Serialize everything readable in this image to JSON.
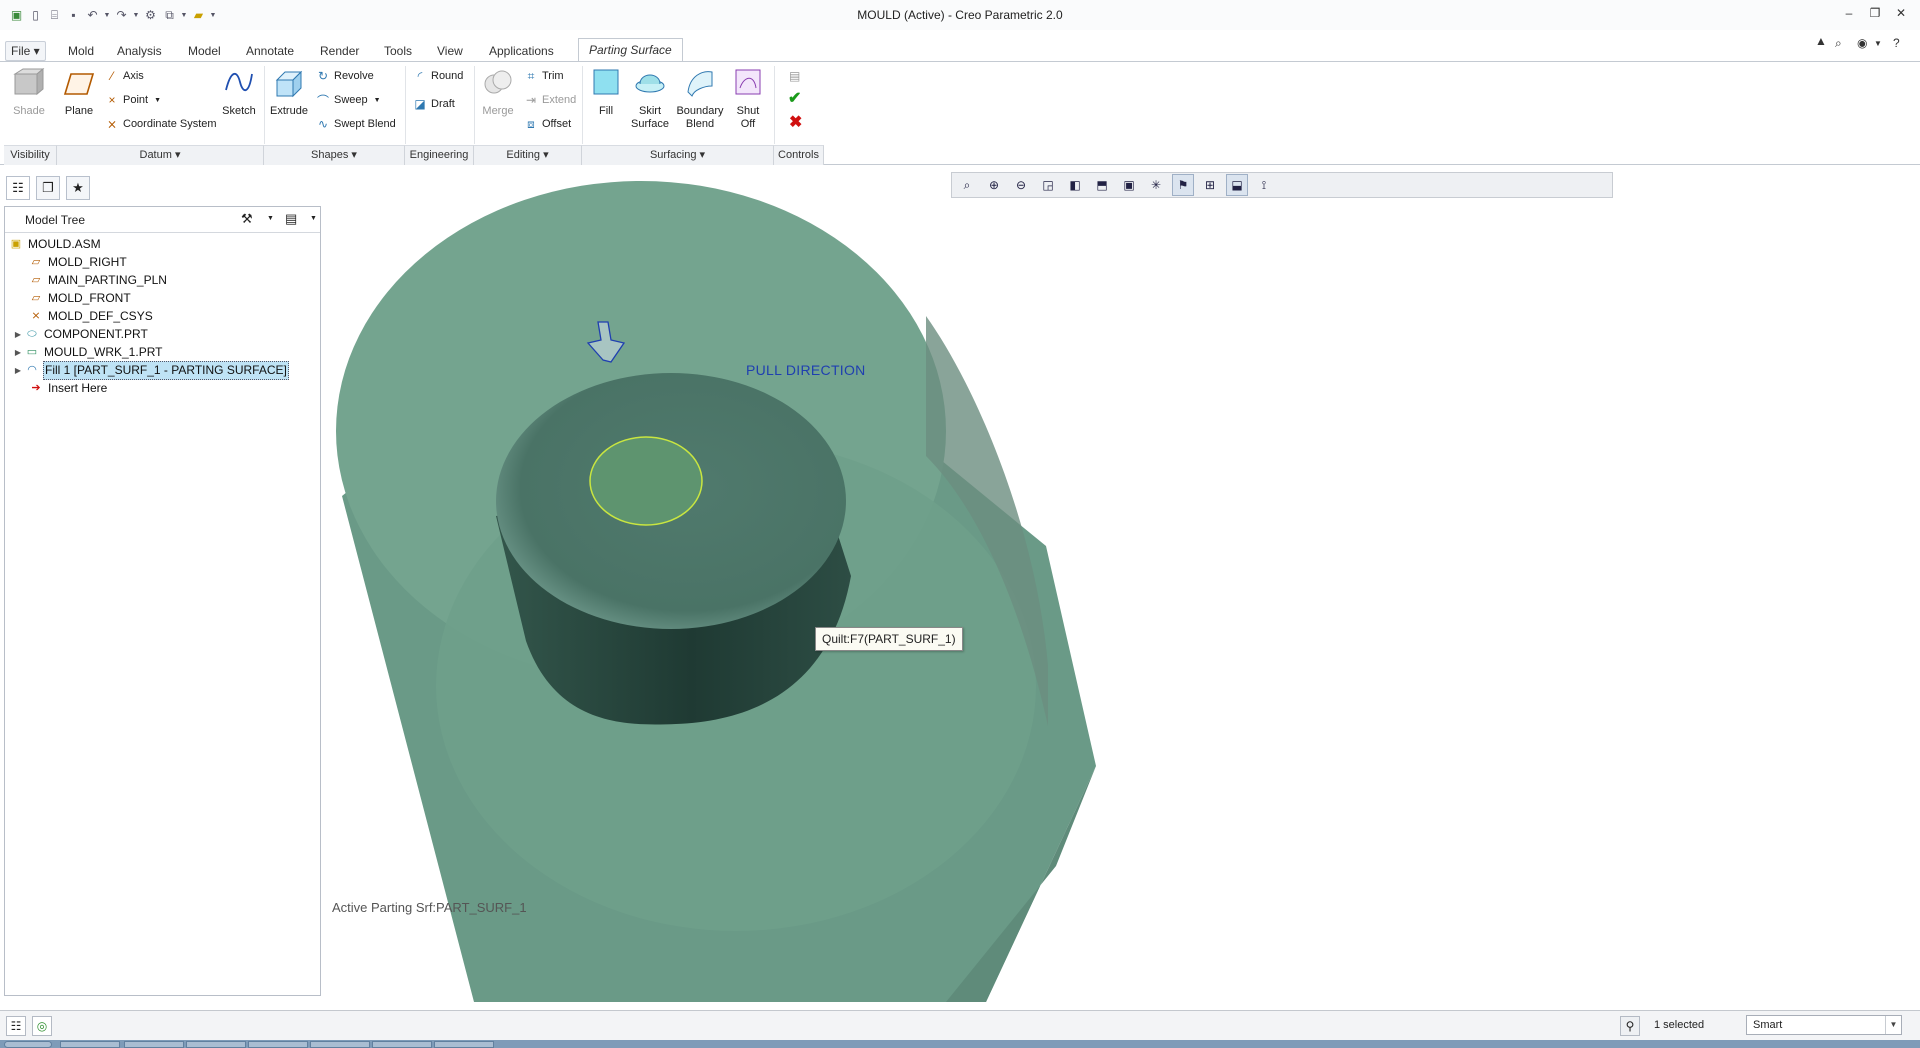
{
  "window": {
    "title": "MOULD (Active) - Creo Parametric 2.0"
  },
  "quick_access": {
    "icons": [
      "app-icon",
      "new-icon",
      "open-icon",
      "save-icon",
      "undo-icon",
      "redo-icon",
      "regenerate-icon",
      "windows-icon",
      "close-window-icon",
      "customize-icon"
    ]
  },
  "tabs": [
    {
      "label": "File"
    },
    {
      "label": "Mold"
    },
    {
      "label": "Analysis"
    },
    {
      "label": "Model"
    },
    {
      "label": "Annotate"
    },
    {
      "label": "Render"
    },
    {
      "label": "Tools"
    },
    {
      "label": "View"
    },
    {
      "label": "Applications"
    },
    {
      "label": "Parting Surface"
    }
  ],
  "ribbon": {
    "shade": "Shade",
    "plane": "Plane",
    "axis": "Axis",
    "point": "Point",
    "coordinate_system": "Coordinate System",
    "sketch": "Sketch",
    "extrude": "Extrude",
    "revolve": "Revolve",
    "sweep": "Sweep",
    "swept_blend": "Swept Blend",
    "round": "Round",
    "draft": "Draft",
    "merge": "Merge",
    "trim": "Trim",
    "extend": "Extend",
    "offset": "Offset",
    "fill": "Fill",
    "skirt_surface": [
      "Skirt",
      "Surface"
    ],
    "boundary_blend": [
      "Boundary",
      "Blend"
    ],
    "shut_off": [
      "Shut",
      "Off"
    ],
    "groups": {
      "visibility": "Visibility",
      "datum": "Datum",
      "shapes": "Shapes",
      "engineering": "Engineering",
      "editing": "Editing",
      "surfacing": "Surfacing",
      "controls": "Controls"
    }
  },
  "model_tree": {
    "title": "Model Tree",
    "items": [
      {
        "label": "MOULD.ASM",
        "icon": "assembly-icon"
      },
      {
        "label": "MOLD_RIGHT",
        "icon": "datum-plane-icon"
      },
      {
        "label": "MAIN_PARTING_PLN",
        "icon": "datum-plane-icon"
      },
      {
        "label": "MOLD_FRONT",
        "icon": "datum-plane-icon"
      },
      {
        "label": "MOLD_DEF_CSYS",
        "icon": "csys-icon"
      },
      {
        "label": "COMPONENT.PRT",
        "icon": "part-icon"
      },
      {
        "label": "MOULD_WRK_1.PRT",
        "icon": "workpiece-icon"
      },
      {
        "label": "Fill 1 [PART_SURF_1 - PARTING SURFACE]",
        "icon": "surface-icon"
      },
      {
        "label": "Insert Here",
        "icon": "insert-arrow-icon"
      }
    ]
  },
  "viewport": {
    "pull_direction_label": "PULL DIRECTION",
    "tooltip": "Quilt:F7(PART_SURF_1)",
    "active_label": "Active Parting Srf:PART_SURF_1",
    "colors": {
      "workpiece": "#5f9e86",
      "part": "#3e6a5e",
      "highlight": "#c9e640",
      "pull_arrow": "#1f3fb0"
    }
  },
  "view_toolbar": {
    "icons": [
      "refit-icon",
      "zoom-in-icon",
      "zoom-out-icon",
      "repaint-icon",
      "display-style-icon",
      "saved-orientations-icon",
      "view-manager-icon",
      "datum-display-icon",
      "annotation-display-icon",
      "spin-center-icon",
      "perspective-icon",
      "model-display-icon",
      "plane-tags-icon"
    ]
  },
  "status": {
    "selected": "1 selected",
    "filter": "Smart"
  }
}
